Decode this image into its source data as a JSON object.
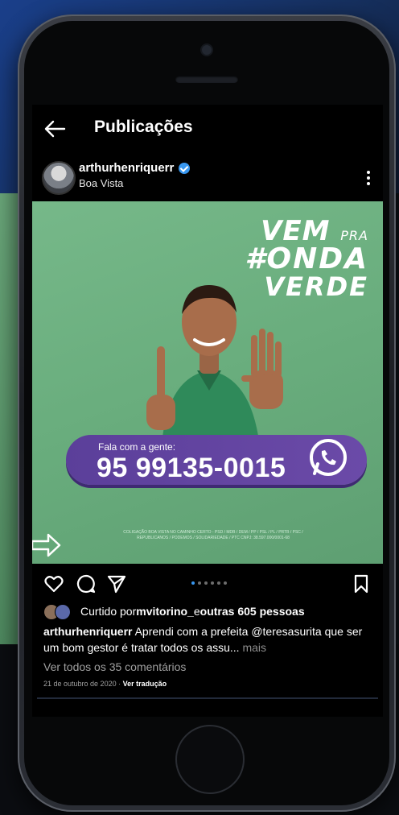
{
  "header": {
    "title": "Publicações"
  },
  "post": {
    "username": "arthurhenriquerr",
    "location": "Boa Vista",
    "image": {
      "slogan_line1": "VEM",
      "slogan_line1_small": "PRA",
      "slogan_line2": "#ONDA",
      "slogan_line3": "VERDE",
      "contact_label": "Fala com a gente:",
      "contact_number": "95 99135-0015",
      "fine_print": "COLIGAÇÃO BOA VISTA NO CAMINHO CERTO - PSD / MDB / DEM / PP / PSL / PL / PRTB / PSC / REPUBLICANOS / PODEMOS / SOLIDARIEDADE / PTC CNPJ: 38.597.000/0001-68"
    },
    "carousel": {
      "count": 6,
      "active_index": 0
    },
    "likes": {
      "prefix": "Curtido por ",
      "first_liker": "mvitorino_",
      "joiner": " e ",
      "others": "outras 605 pessoas"
    },
    "caption": {
      "username": "arthurhenriquerr",
      "text": " Aprendi com a prefeita @teresasurita que ser um bom gestor é tratar todos os assu...",
      "more": " mais"
    },
    "view_comments": "Ver todos os 35 comentários",
    "date": "21 de outubro de 2020 · ",
    "translate": "Ver tradução"
  },
  "colors": {
    "accent": "#3897f0",
    "post_green": "#6aad7d",
    "pill_purple": "#5b3f9a"
  },
  "icons": [
    "back-arrow-icon",
    "verified-icon",
    "more-icon",
    "like-icon",
    "comment-icon",
    "share-icon",
    "save-icon",
    "whatsapp-icon"
  ]
}
